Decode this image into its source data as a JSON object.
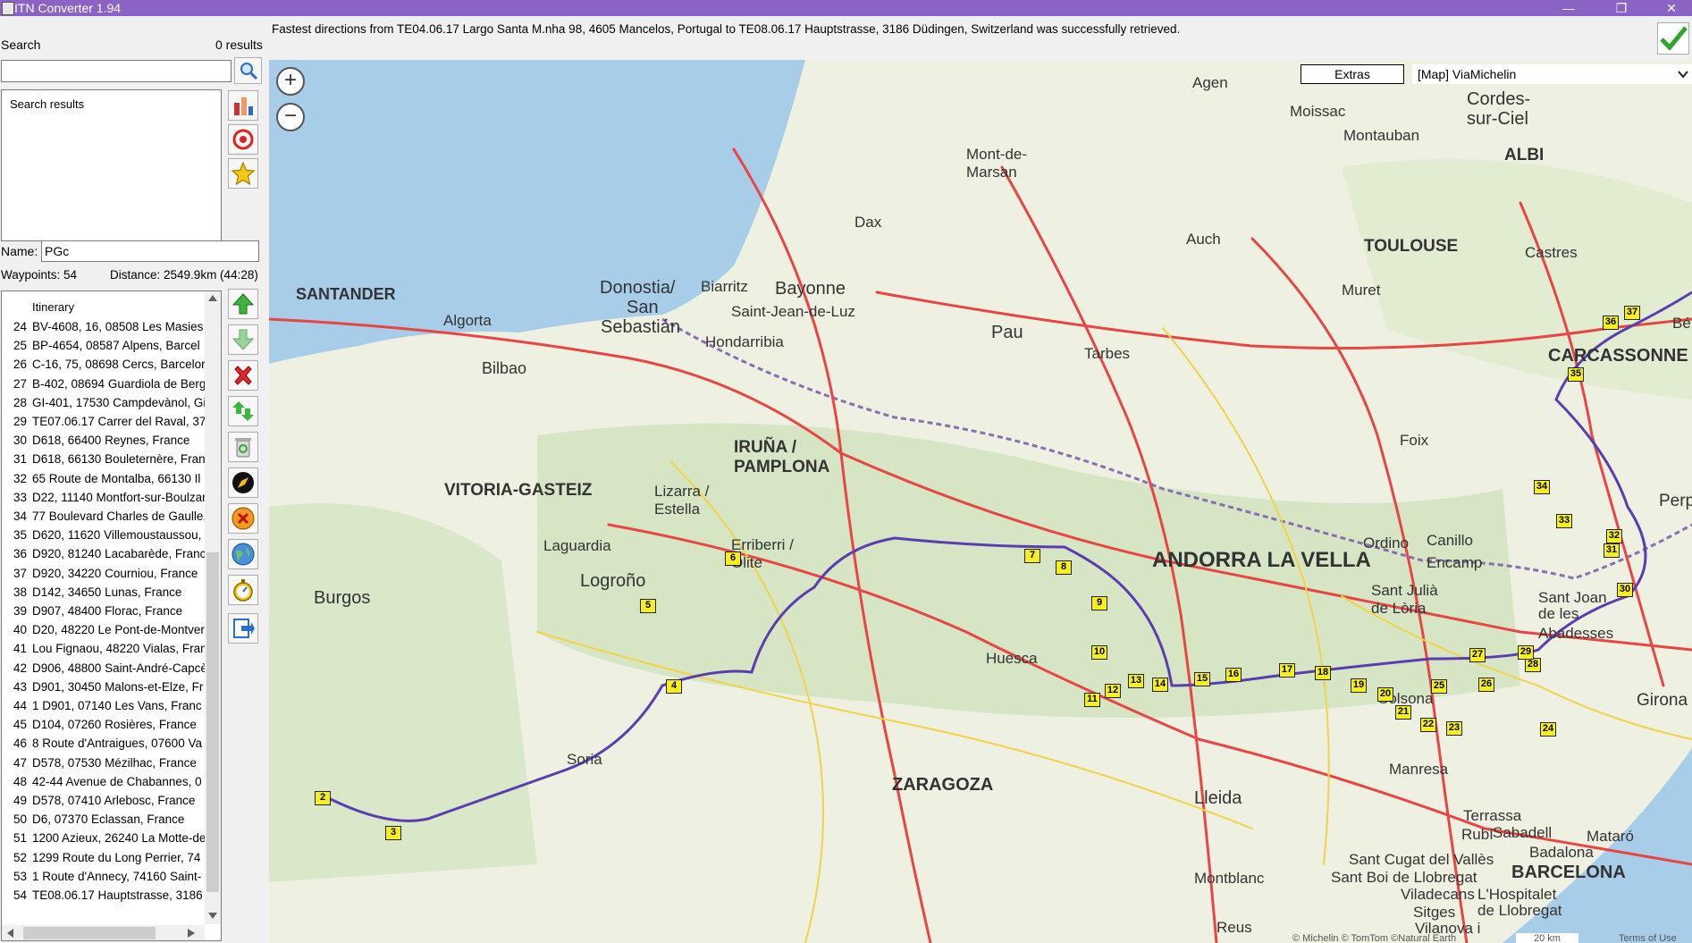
{
  "window": {
    "title": "ITN Converter 1.94",
    "minimize": "—",
    "maximize": "❐",
    "close": "✕"
  },
  "search": {
    "label": "Search",
    "count": "0 results",
    "results_label": "Search results"
  },
  "route": {
    "name_label": "Name:",
    "name_value": "PGc",
    "waypoints": "Waypoints: 54",
    "distance": "Distance: 2549.9km (44:28)"
  },
  "itinerary": {
    "header": "Itinerary",
    "rows": [
      {
        "n": "24",
        "t": "BV-4608, 16, 08508 Les Masies"
      },
      {
        "n": "25",
        "t": "BP-4654, 08587 Alpens, Barcel"
      },
      {
        "n": "26",
        "t": "C-16, 75, 08698 Cercs, Barcelor"
      },
      {
        "n": "27",
        "t": "B-402, 08694 Guardiola de Berg"
      },
      {
        "n": "28",
        "t": "GI-401, 17530 Campdevànol, Gi"
      },
      {
        "n": "29",
        "t": "TE07.06.17 Carrer del Raval, 37"
      },
      {
        "n": "30",
        "t": "D618, 66400 Reynes, France"
      },
      {
        "n": "31",
        "t": "D618, 66130 Bouleternère, Fran"
      },
      {
        "n": "32",
        "t": "65 Route de Montalba, 66130 Il"
      },
      {
        "n": "33",
        "t": "D22, 11140 Montfort-sur-Boulzar"
      },
      {
        "n": "34",
        "t": "77 Boulevard Charles de Gaulle,"
      },
      {
        "n": "35",
        "t": "D620, 11620 Villemoustaussou,"
      },
      {
        "n": "36",
        "t": "D920, 81240 Lacabarède, Franc"
      },
      {
        "n": "37",
        "t": "D920, 34220 Courniou, France"
      },
      {
        "n": "38",
        "t": "D142, 34650 Lunas, France"
      },
      {
        "n": "39",
        "t": "D907, 48400 Florac, France"
      },
      {
        "n": "40",
        "t": "D20, 48220 Le Pont-de-Montver"
      },
      {
        "n": "41",
        "t": "Lou Fignaou, 48220 Vialas, Fran"
      },
      {
        "n": "42",
        "t": "D906, 48800 Saint-André-Capcè"
      },
      {
        "n": "43",
        "t": "D901, 30450 Malons-et-Elze, Fr"
      },
      {
        "n": "44",
        "t": "1 D901, 07140 Les Vans, Franc"
      },
      {
        "n": "45",
        "t": "D104, 07260 Rosières, France"
      },
      {
        "n": "46",
        "t": "8 Route d'Antraigues, 07600 Va"
      },
      {
        "n": "47",
        "t": "D578, 07530 Mézilhac, France"
      },
      {
        "n": "48",
        "t": "42-44 Avenue de Chabannes, 0"
      },
      {
        "n": "49",
        "t": "D578, 07410 Arlebosc, France"
      },
      {
        "n": "50",
        "t": "D6, 07370 Eclassan, France"
      },
      {
        "n": "51",
        "t": "1200 Azieux, 26240 La Motte-de"
      },
      {
        "n": "52",
        "t": "1299 Route du Long Perrier, 74"
      },
      {
        "n": "53",
        "t": "1 Route d'Annecy, 74160 Saint-"
      },
      {
        "n": "54",
        "t": "TE08.06.17 Hauptstrasse, 3186"
      }
    ]
  },
  "status_message": "Fastest directions from TE04.06.17 Largo Santa M.nha 98, 4605 Mancelos, Portugal to TE08.06.17 Hauptstrasse, 3186 Düdingen, Switzerland was successfully retrieved.",
  "map": {
    "extras_label": "Extras",
    "provider": "[Map] ViaMichelin",
    "zoom_in": "+",
    "zoom_out": "−",
    "attribution": "© Michelin © TomTom ©Natural Earth",
    "scale": "20 km",
    "terms": "Terms of Use",
    "cities": [
      {
        "name": "SANTANDER"
      },
      {
        "name": "Bilbao"
      },
      {
        "name": "VITORIA-GASTEIZ"
      },
      {
        "name": "IRUÑA /"
      },
      {
        "name": "PAMPLONA"
      },
      {
        "name": "Logroño"
      },
      {
        "name": "Burgos"
      },
      {
        "name": "ZARAGOZA"
      },
      {
        "name": "Huesca"
      },
      {
        "name": "Lleida"
      },
      {
        "name": "ANDORRA LA VELLA"
      },
      {
        "name": "BARCELONA"
      },
      {
        "name": "TOULOUSE"
      },
      {
        "name": "CARCASSONNE"
      },
      {
        "name": "ALBI"
      },
      {
        "name": "Pau"
      },
      {
        "name": "Tarbes"
      },
      {
        "name": "Bayonne"
      },
      {
        "name": "Biarritz"
      },
      {
        "name": "Dax"
      },
      {
        "name": "Auch"
      },
      {
        "name": "Agen"
      },
      {
        "name": "Montauban"
      },
      {
        "name": "Moissac"
      },
      {
        "name": "Soria"
      },
      {
        "name": "Foix"
      },
      {
        "name": "Manresa"
      },
      {
        "name": "Girona"
      },
      {
        "name": "Solsona"
      },
      {
        "name": "Donostia/"
      },
      {
        "name": "San"
      },
      {
        "name": "Sebastián"
      },
      {
        "name": "Algorta"
      },
      {
        "name": "Laguardia"
      },
      {
        "name": "Lizarra /"
      },
      {
        "name": "Estella"
      },
      {
        "name": "Erriberri /"
      },
      {
        "name": "Olite"
      },
      {
        "name": "Mont-de-"
      },
      {
        "name": "Marsan"
      },
      {
        "name": "Cordes-"
      },
      {
        "name": "sur-Ciel"
      },
      {
        "name": "Castres"
      },
      {
        "name": "Muret"
      },
      {
        "name": "Hondarribia"
      },
      {
        "name": "Saint-Jean-de-Luz"
      },
      {
        "name": "Ordino"
      },
      {
        "name": "Canillo"
      },
      {
        "name": "Encamp"
      },
      {
        "name": "Sant Julià"
      },
      {
        "name": "de Lòria"
      },
      {
        "name": "Sant Joan"
      },
      {
        "name": "de les"
      },
      {
        "name": "Abadesses"
      },
      {
        "name": "Terrassa"
      },
      {
        "name": "Sabadell"
      },
      {
        "name": "Rubí"
      },
      {
        "name": "Mataró"
      },
      {
        "name": "Badalona"
      },
      {
        "name": "Sant Cugat del Vallès"
      },
      {
        "name": "Sant Boi de Llobregat"
      },
      {
        "name": "Viladecans"
      },
      {
        "name": "L'Hospitalet"
      },
      {
        "name": "de Llobregat"
      },
      {
        "name": "Sitges"
      },
      {
        "name": "Vilanova i"
      },
      {
        "name": "Montblanc"
      },
      {
        "name": "Reus"
      },
      {
        "name": "Perp"
      },
      {
        "name": "Bé"
      }
    ],
    "waypoints": [
      "2",
      "3",
      "4",
      "5",
      "6",
      "7",
      "8",
      "9",
      "10",
      "11",
      "12",
      "13",
      "14",
      "15",
      "16",
      "17",
      "18",
      "19",
      "20",
      "21",
      "22",
      "23",
      "24",
      "25",
      "26",
      "27",
      "28",
      "29",
      "30",
      "31",
      "32",
      "33",
      "34",
      "35",
      "36",
      "37"
    ]
  },
  "colors": {
    "titlebar": "#8a63c4",
    "route": "#5a3db0",
    "marker": "#f5ef1e",
    "sea": "#a8cde8",
    "land": "#eef0e2"
  }
}
